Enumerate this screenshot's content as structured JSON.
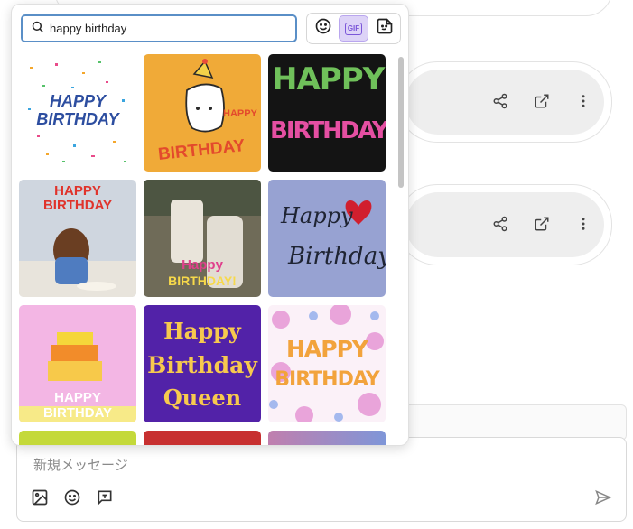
{
  "search": {
    "value": "happy birthday"
  },
  "tabs": [
    {
      "name": "emoji",
      "icon": "smiley-icon",
      "active": false
    },
    {
      "name": "gif",
      "label": "GIF",
      "active": true
    },
    {
      "name": "sticker",
      "icon": "sticker-icon",
      "active": false
    }
  ],
  "gifs": [
    {
      "text": "HAPPY BIRTHDAY",
      "style": "confetti"
    },
    {
      "text": "HAPPY",
      "text2": "BIRTHDAY",
      "style": "cat-party"
    },
    {
      "text": "HAPPY",
      "text2": "BIRTHDAY",
      "style": "glitter-black"
    },
    {
      "text": "HAPPY",
      "text2": "BIRTHDAY",
      "style": "dog-party"
    },
    {
      "text": "Happy",
      "text2": "BIRTHDAY!",
      "style": "cake-carry"
    },
    {
      "text": "Happy",
      "text2": "Birthday",
      "style": "handwritten-heart"
    },
    {
      "text": "HAPPY BIRTHDAY",
      "style": "cake-character"
    },
    {
      "text": "Happy",
      "text2": "Birthday",
      "text3": "Queen",
      "style": "purple-gold"
    },
    {
      "text": "HAPPY",
      "text2": "BIRTHDAY",
      "style": "watercolor-flowers"
    },
    {
      "style": "partial-green"
    },
    {
      "style": "partial-red"
    },
    {
      "style": "partial-gradient"
    }
  ],
  "compose": {
    "placeholder": "新規メッセージ"
  },
  "colors": {
    "accent": "#7b56d9",
    "search_border": "#5a8fc7",
    "active_tab_bg": "#ddd3f7"
  }
}
